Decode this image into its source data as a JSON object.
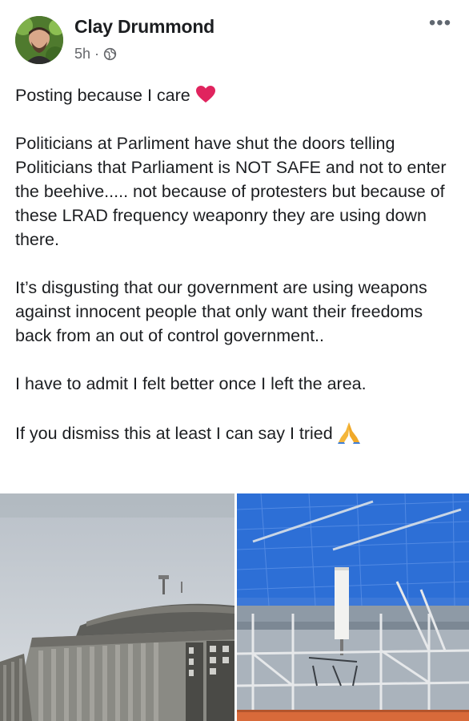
{
  "author": {
    "name": "Clay Drummond",
    "time": "5h",
    "audience_icon": "globe-icon"
  },
  "header": {
    "more_label": "•••"
  },
  "post": {
    "paragraphs": [
      "Posting because I care",
      "Politicians at Parliment have shut the doors telling Politicians that Parliament is NOT SAFE and not to enter the beehive..... not because of protesters but because of these LRAD frequency weaponry they are using down there.",
      "It’s disgusting that our government are using weapons against innocent people that only want their freedoms back from an out of control government..",
      "I have to admit I felt better once I left the area.",
      "If you dismiss this at least I can say I tried"
    ],
    "emojis": [
      "heart-emoji",
      "pray-emoji"
    ]
  },
  "photos": [
    {
      "name": "photo-parliament-beehive"
    },
    {
      "name": "photo-scaffolding-antenna"
    }
  ],
  "colors": {
    "text": "#1c1e21",
    "secondary_text": "#65676b",
    "heart": "#e0245e",
    "scaffold_blue": "#2d6fd6"
  }
}
